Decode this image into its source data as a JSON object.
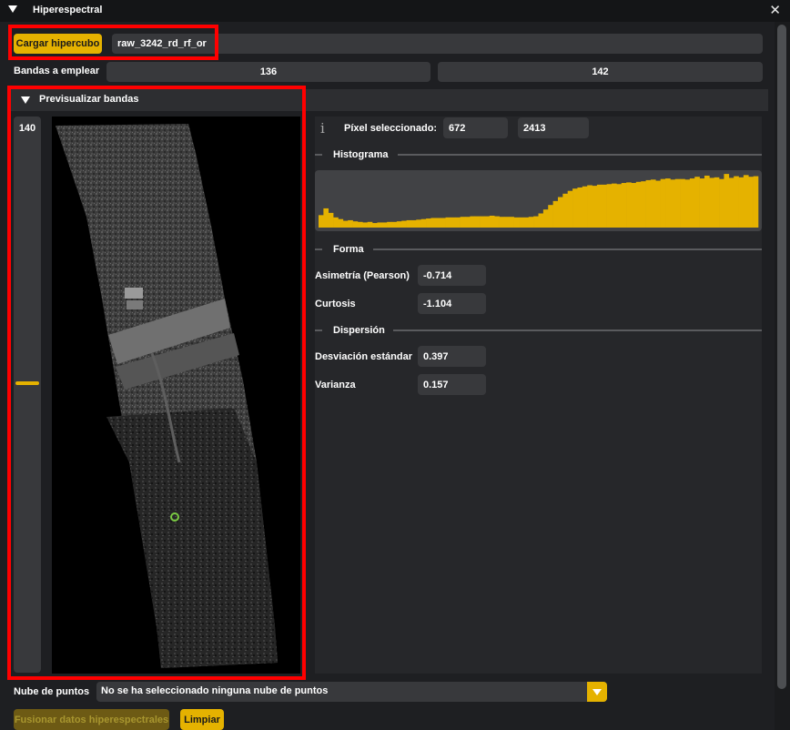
{
  "window": {
    "title": "Hiperespectral",
    "close_glyph": "✕"
  },
  "hypercube": {
    "load_button": "Cargar hipercubo",
    "file_name": "raw_3242_rd_rf_or"
  },
  "bands": {
    "label": "Bandas a emplear",
    "start": "136",
    "end": "142"
  },
  "preview": {
    "header": "Previsualizar bandas",
    "band_value": "140",
    "band_level_fraction": 0.48,
    "selected_point_marker": "green-circle"
  },
  "pixel": {
    "label": "Píxel seleccionado:",
    "x": "672",
    "y": "2413",
    "info_glyph": "i"
  },
  "histogram": {
    "label": "Histograma",
    "fill_color": "#e5b200",
    "levels": [
      0.22,
      0.34,
      0.26,
      0.18,
      0.15,
      0.12,
      0.13,
      0.11,
      0.1,
      0.09,
      0.1,
      0.08,
      0.09,
      0.09,
      0.1,
      0.1,
      0.11,
      0.12,
      0.13,
      0.13,
      0.14,
      0.15,
      0.16,
      0.17,
      0.17,
      0.17,
      0.18,
      0.18,
      0.18,
      0.19,
      0.19,
      0.2,
      0.2,
      0.2,
      0.2,
      0.21,
      0.2,
      0.19,
      0.19,
      0.19,
      0.18,
      0.18,
      0.18,
      0.19,
      0.2,
      0.25,
      0.32,
      0.4,
      0.47,
      0.54,
      0.6,
      0.65,
      0.69,
      0.71,
      0.73,
      0.75,
      0.74,
      0.76,
      0.76,
      0.77,
      0.78,
      0.77,
      0.79,
      0.8,
      0.79,
      0.81,
      0.82,
      0.84,
      0.85,
      0.83,
      0.86,
      0.87,
      0.85,
      0.86,
      0.86,
      0.85,
      0.87,
      0.9,
      0.87,
      0.92,
      0.88,
      0.89,
      0.86,
      0.95,
      0.88,
      0.91,
      0.89,
      0.93,
      0.9,
      0.91
    ]
  },
  "shape": {
    "label": "Forma",
    "skew_label": "Asimetría (Pearson)",
    "skew_value": "-0.714",
    "kurt_label": "Curtosis",
    "kurt_value": "-1.104"
  },
  "dispersion": {
    "label": "Dispersión",
    "std_label": "Desviación estándar",
    "std_value": "0.397",
    "var_label": "Varianza",
    "var_value": "0.157"
  },
  "point_cloud": {
    "label": "Nube de puntos",
    "selected": "No se ha seleccionado ninguna nube de puntos"
  },
  "actions": {
    "fuse": "Fusionar datos hiperespectrales",
    "clear": "Limpiar"
  },
  "colors": {
    "accent": "#e5b200",
    "highlight": "#ff0000",
    "marker": "#7ac943"
  }
}
